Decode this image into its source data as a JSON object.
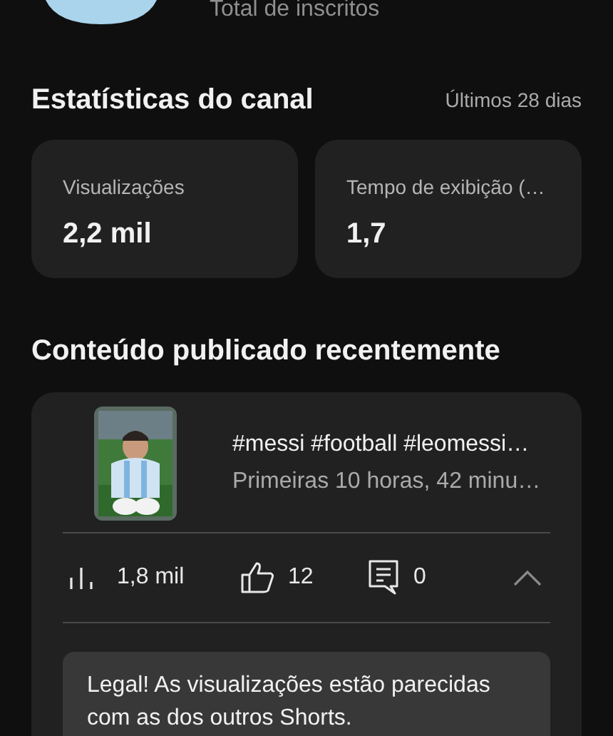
{
  "channel": {
    "subscribers_label": "Total de inscritos"
  },
  "channel_stats": {
    "title": "Estatísticas do canal",
    "period": "Últimos 28 dias",
    "cards": [
      {
        "label": "Visualizações",
        "value": "2,2 mil"
      },
      {
        "label": "Tempo de exibição (…",
        "value": "1,7"
      }
    ]
  },
  "recent_content": {
    "title": "Conteúdo publicado recentemente",
    "items": [
      {
        "title": "#messi #football #leomessi…",
        "subtitle": "Primeiras 10 horas, 42 minu…",
        "views": "1,8 mil",
        "likes": "12",
        "comments": "0",
        "expanded": true,
        "insight": "Legal! As visualizações estão parecidas com as dos outros Shorts."
      }
    ]
  }
}
